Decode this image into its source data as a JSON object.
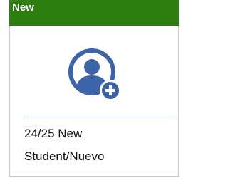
{
  "tile": {
    "header_label": "New",
    "label_line1": "24/25 New",
    "label_line2": "Student/Nuevo",
    "icon": "add-user-icon",
    "colors": {
      "header": "#2e7d0f",
      "icon": "#3d63a8",
      "divider": "#3d63a8",
      "text": "#111111"
    }
  }
}
